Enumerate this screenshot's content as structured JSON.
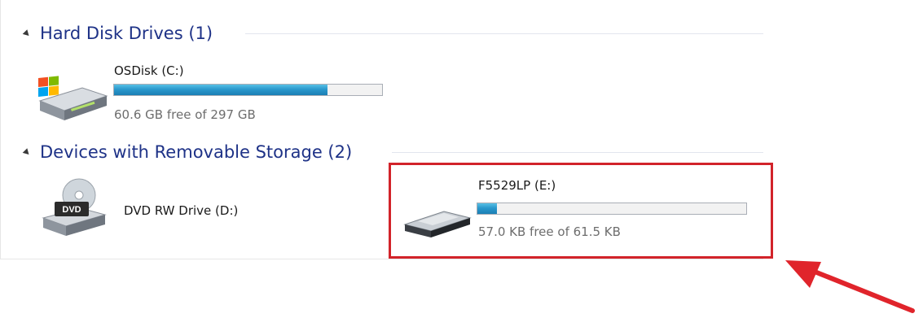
{
  "groups": {
    "hard_disk": {
      "title": "Hard Disk Drives (1)"
    },
    "removable": {
      "title": "Devices with Removable Storage (2)"
    }
  },
  "drives": [
    {
      "name": "OSDisk (C:)",
      "free_text": "60.6 GB free of 297 GB",
      "used_fraction": 0.796,
      "icon": "windows-hard-drive-icon"
    },
    {
      "name": "DVD RW Drive (D:)",
      "icon": "dvd-drive-icon",
      "badge": "DVD"
    },
    {
      "name": "F5529LP (E:)",
      "free_text": "57.0 KB free of 61.5 KB",
      "used_fraction": 0.073,
      "icon": "removable-drive-icon"
    }
  ],
  "colors": {
    "group_title": "#1e3287",
    "bar_fill": "#2a98cc",
    "highlight": "#d2232a",
    "arrow": "#e0242b"
  }
}
